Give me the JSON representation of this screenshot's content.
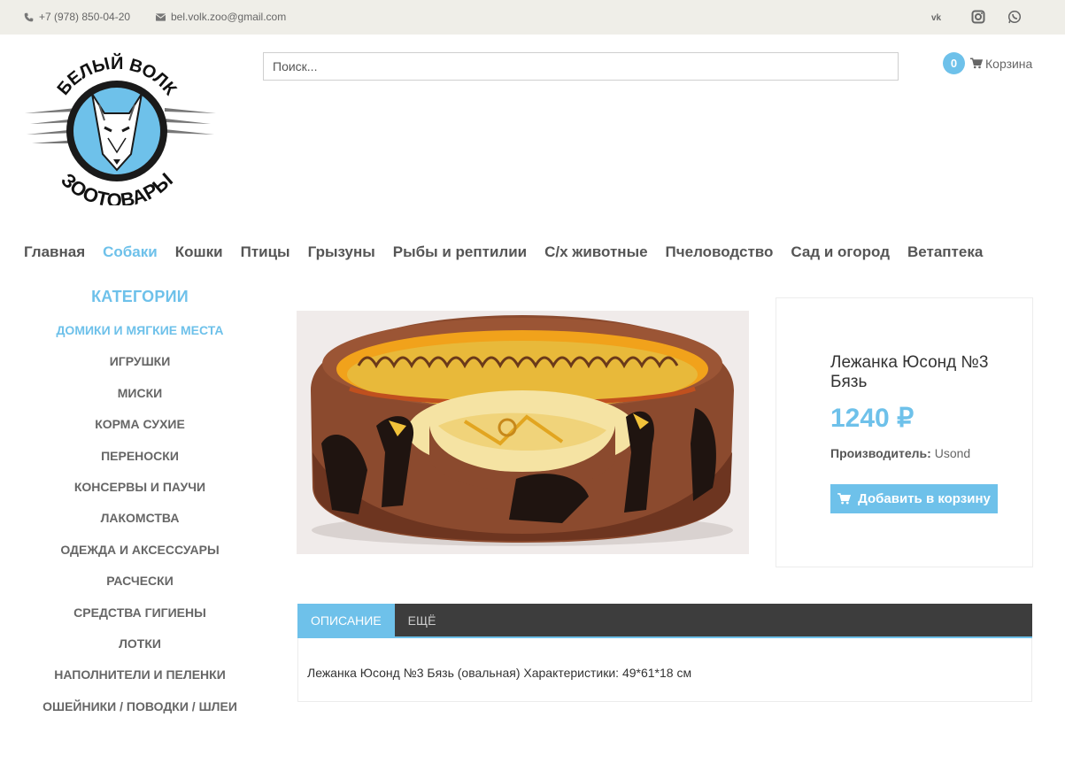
{
  "topbar": {
    "phone": "+7 (978) 850-04-20",
    "email": "bel.volk.zoo@gmail.com",
    "social": [
      "vk-icon",
      "instagram-icon",
      "whatsapp-icon"
    ]
  },
  "logo": {
    "top_text": "БЕЛЫЙ ВОЛК",
    "bottom_text": "ЗООТОВАРЫ"
  },
  "search": {
    "placeholder": "Поиск...",
    "value": ""
  },
  "cart": {
    "count": "0",
    "label": "Корзина"
  },
  "nav": {
    "items": [
      {
        "label": "Главная",
        "active": false
      },
      {
        "label": "Собаки",
        "active": true
      },
      {
        "label": "Кошки",
        "active": false
      },
      {
        "label": "Птицы",
        "active": false
      },
      {
        "label": "Грызуны",
        "active": false
      },
      {
        "label": "Рыбы и рептилии",
        "active": false
      },
      {
        "label": "С/х животные",
        "active": false
      },
      {
        "label": "Пчеловодство",
        "active": false
      },
      {
        "label": "Сад и огород",
        "active": false
      },
      {
        "label": "Ветаптека",
        "active": false
      }
    ]
  },
  "sidebar": {
    "heading": "КАТЕГОРИИ",
    "items": [
      {
        "label": "ДОМИКИ И МЯГКИЕ МЕСТА",
        "active": true
      },
      {
        "label": "ИГРУШКИ",
        "active": false
      },
      {
        "label": "МИСКИ",
        "active": false
      },
      {
        "label": "КОРМА СУХИЕ",
        "active": false
      },
      {
        "label": "ПЕРЕНОСКИ",
        "active": false
      },
      {
        "label": "КОНСЕРВЫ И ПАУЧИ",
        "active": false
      },
      {
        "label": "ЛАКОМСТВА",
        "active": false
      },
      {
        "label": "ОДЕЖДА И АКСЕССУАРЫ",
        "active": false
      },
      {
        "label": "РАСЧЕСКИ",
        "active": false
      },
      {
        "label": "СРЕДСТВА ГИГИЕНЫ",
        "active": false
      },
      {
        "label": "ЛОТКИ",
        "active": false
      },
      {
        "label": "НАПОЛНИТЕЛИ И ПЕЛЕНКИ",
        "active": false
      },
      {
        "label": "ОШЕЙНИКИ / ПОВОДКИ / ШЛЕИ",
        "active": false
      }
    ]
  },
  "product": {
    "title": "Лежанка Юсонд №3 Бязь",
    "price": "1240 ₽",
    "maker_label": "Производитель:",
    "maker_value": "Usond",
    "add_button": "Добавить в корзину"
  },
  "tabs": {
    "items": [
      {
        "label": "ОПИСАНИЕ",
        "active": true
      },
      {
        "label": "ЕЩЁ",
        "active": false
      }
    ],
    "description": "Лежанка Юсонд №3 Бязь (овальная) Характеристики: 49*61*18 см"
  },
  "colors": {
    "accent": "#6ec1ea",
    "topbar_bg": "#efeee8",
    "tabs_bg": "#3d3d3d"
  }
}
